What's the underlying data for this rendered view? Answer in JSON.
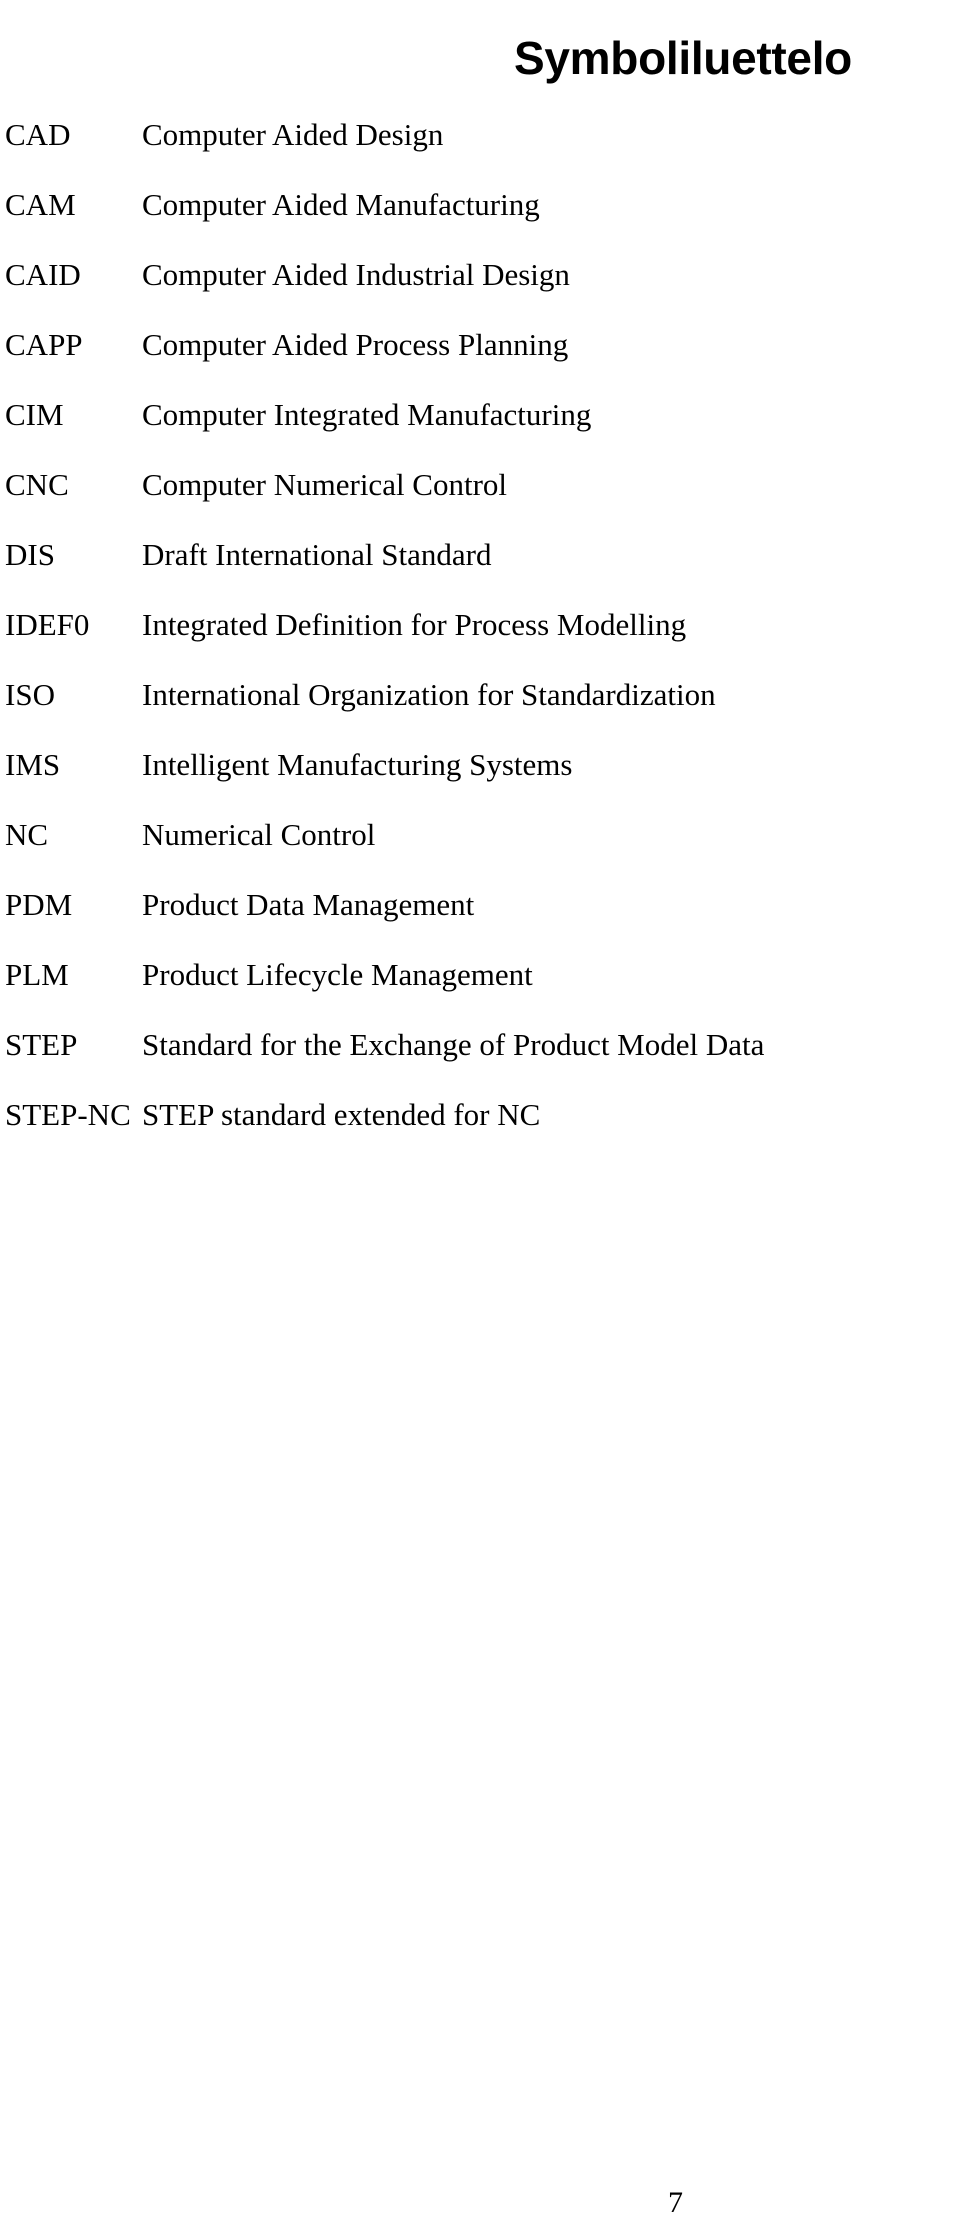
{
  "document": {
    "title": "Symboliluettelo",
    "page_number": "7",
    "background_color": "#ffffff",
    "text_color": "#000000"
  },
  "abbreviations": [
    {
      "term": "CAD",
      "definition": "Computer Aided Design"
    },
    {
      "term": "CAM",
      "definition": "Computer Aided Manufacturing"
    },
    {
      "term": "CAID",
      "definition": "Computer Aided Industrial Design"
    },
    {
      "term": "CAPP",
      "definition": "Computer Aided Process Planning"
    },
    {
      "term": "CIM",
      "definition": "Computer Integrated Manufacturing"
    },
    {
      "term": "CNC",
      "definition": "Computer Numerical Control"
    },
    {
      "term": "DIS",
      "definition": "Draft International Standard"
    },
    {
      "term": "IDEF0",
      "definition": "Integrated Definition for Process Modelling"
    },
    {
      "term": "ISO",
      "definition": "International Organization for Standardization"
    },
    {
      "term": "IMS",
      "definition": "Intelligent Manufacturing Systems"
    },
    {
      "term": "NC",
      "definition": "Numerical Control"
    },
    {
      "term": "PDM",
      "definition": "Product Data Management"
    },
    {
      "term": "PLM",
      "definition": "Product Lifecycle Management"
    },
    {
      "term": "STEP",
      "definition": "Standard for the Exchange of Product Model Data"
    },
    {
      "term": "STEP-NC",
      "definition": "STEP standard extended for NC"
    }
  ]
}
